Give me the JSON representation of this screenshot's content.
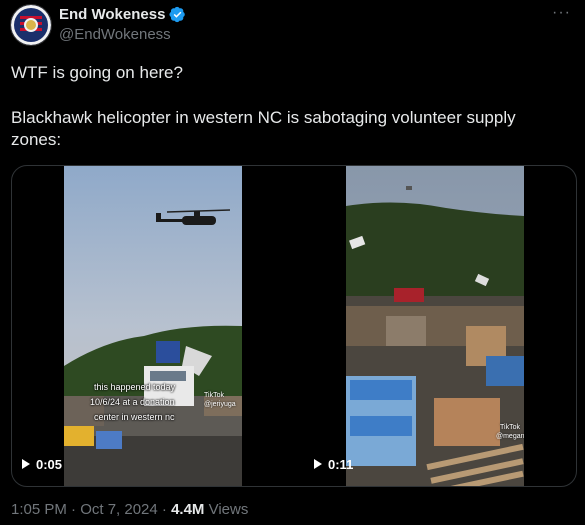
{
  "author": {
    "display_name": "End Wokeness",
    "handle": "@EndWokeness"
  },
  "tweet": {
    "line1": "WTF is going on here?",
    "line2": "Blackhawk helicopter in western NC is sabotaging volunteer supply",
    "line3": "zones:"
  },
  "media": {
    "video1": {
      "duration": "0:05",
      "caption_line1": "this happened today",
      "caption_line2": "10/6/24 at a donation",
      "caption_line3": "center in western nc",
      "tiktok_label": "TikTok",
      "tiktok_user": "@jeriyuga"
    },
    "video2": {
      "duration": "0:11",
      "tiktok_label": "TikTok",
      "tiktok_user": "@meganbeas"
    }
  },
  "meta": {
    "timestamp": "1:05 PM · Oct 7, 2024 · ",
    "views_count": "4.4M",
    "views_label": " Views"
  },
  "colors": {
    "background": "#000000",
    "text_primary": "#e7e9ea",
    "text_secondary": "#71767b",
    "verified_blue": "#1d9bf0"
  }
}
